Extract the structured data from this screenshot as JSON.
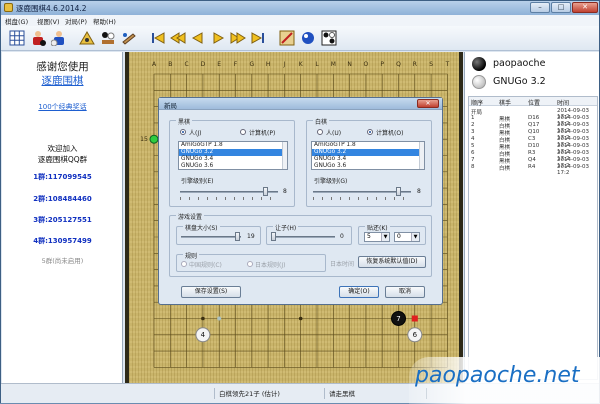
{
  "window": {
    "title": "逐鹿围棋4.6.2014.2",
    "caption_buttons": {
      "minimize": "–",
      "maximize": "□",
      "close": "✕"
    }
  },
  "menu": [
    "棋盘(G)",
    "视图(V)",
    "对局(P)",
    "帮助(H)"
  ],
  "toolbar": {
    "icons": [
      "board-grid-icon",
      "human-vs-human-icon",
      "human-vs-computer-icon",
      "players-icon",
      "kifu-icon",
      "settings-icon",
      "first-move-icon",
      "back-ten-icon",
      "back-icon",
      "forward-icon",
      "forward-ten-icon",
      "last-move-icon",
      "edit-board-icon",
      "stones-icon",
      "mark-icon"
    ]
  },
  "left_panel": {
    "thanks": "感谢您使用",
    "app_link": "逐鹿围棋",
    "manuals_link": "100个经典奖话",
    "welcome": "欢迎加入",
    "qq_group": "逐鹿围棋QQ群",
    "groups": [
      "1群:117099545",
      "2群:108484460",
      "3群:205127551",
      "4群:130957499"
    ],
    "group5": "5群(尚未启用)"
  },
  "board": {
    "col_labels": [
      "A",
      "B",
      "C",
      "D",
      "E",
      "F",
      "G",
      "H",
      "J",
      "K",
      "L",
      "M",
      "N",
      "O",
      "P",
      "Q",
      "R",
      "S",
      "T"
    ],
    "visible_row_label": "15",
    "stones": [
      {
        "color": "white",
        "label": "4"
      },
      {
        "color": "black",
        "label": "7"
      },
      {
        "color": "white",
        "label": "6"
      }
    ]
  },
  "players": {
    "black": "paopaoche",
    "white": "GNUGo 3.2"
  },
  "move_list": {
    "headers": [
      "顺序",
      "棋手",
      "位置",
      "时间"
    ],
    "rows": [
      [
        "开局",
        "",
        "",
        "2014-09-03 17:2"
      ],
      [
        "1",
        "黑棋",
        "D16",
        "2014-09-03 17:2"
      ],
      [
        "2",
        "白棋",
        "Q17",
        "2014-09-03 17:2"
      ],
      [
        "3",
        "黑棋",
        "Q10",
        "2014-09-03 17:2"
      ],
      [
        "4",
        "白棋",
        "C3",
        "2014-09-03 17:2"
      ],
      [
        "5",
        "黑棋",
        "D10",
        "2014-09-03 17:2"
      ],
      [
        "6",
        "白棋",
        "R3",
        "2014-09-03 17:2"
      ],
      [
        "7",
        "黑棋",
        "Q4",
        "2014-09-03 17:2"
      ],
      [
        "8",
        "白棋",
        "R4",
        "2014-09-03 17:2"
      ]
    ]
  },
  "status": {
    "mid": "白棋领先21子 (估计)",
    "right": "请走黑棋"
  },
  "watermark": "paopaoche.net",
  "dialog": {
    "title": "新局",
    "close": "✕",
    "black_group": "黑棋",
    "white_group": "白棋",
    "human": "人(J)",
    "computer": "计算机(P)",
    "human_w": "人(U)",
    "computer_w": "计算机(O)",
    "engines": [
      "AmiGoGTP 1.8",
      "GNUGo 3.2",
      "GNUGo 3.4",
      "GNUGo 3.6",
      "Fuego 0.4"
    ],
    "engine_level_label": "引擎级别(E)",
    "engine_level_label_w": "引擎级别(G)",
    "engine_level_value": "8",
    "engine_level_value_w": "8",
    "game_settings": "游戏设置",
    "board_size_label": "棋盘大小(S)",
    "board_size_value": "19",
    "handicap_label": "让子(H)",
    "handicap_value": "0",
    "komi_label": "贴还(K)",
    "komi_a": "5",
    "komi_b": "0",
    "rules_label": "规则",
    "rule_cn": "中国规则(C)",
    "rule_jp": "日本规则(J)",
    "rule_time": "日本时间",
    "reset_defaults": "恢复系统默认值(D)",
    "save_settings": "保存设置(S)",
    "ok": "确定(O)",
    "cancel": "取消"
  }
}
